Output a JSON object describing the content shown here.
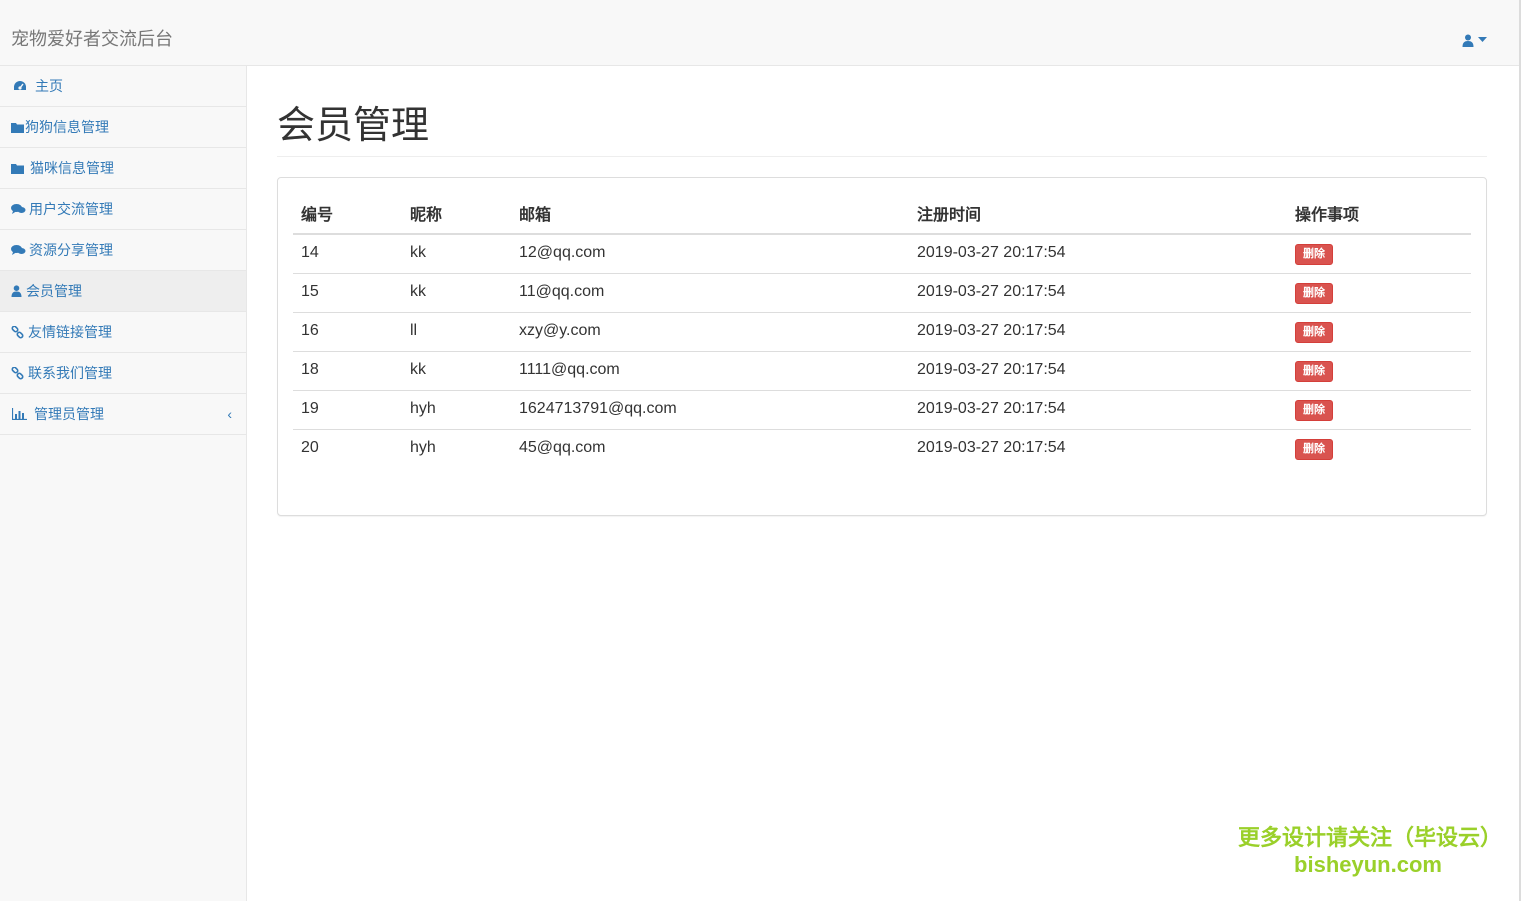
{
  "app": {
    "brand": "宠物爱好者交流后台"
  },
  "sidebar": {
    "items": [
      {
        "label": "主页",
        "icon": "dashboard-icon"
      },
      {
        "label": "狗狗信息管理",
        "icon": "folder-icon"
      },
      {
        "label": "猫咪信息管理",
        "icon": "folder-icon"
      },
      {
        "label": "用户交流管理",
        "icon": "comments-icon"
      },
      {
        "label": "资源分享管理",
        "icon": "comments-icon"
      },
      {
        "label": "会员管理",
        "icon": "user-icon",
        "active": true
      },
      {
        "label": "友情链接管理",
        "icon": "link-icon"
      },
      {
        "label": "联系我们管理",
        "icon": "link-icon"
      },
      {
        "label": "管理员管理",
        "icon": "bar-chart-icon",
        "arrow": "‹"
      }
    ]
  },
  "main": {
    "title": "会员管理",
    "table": {
      "headers": [
        "编号",
        "昵称",
        "邮箱",
        "注册时间",
        "操作事项"
      ],
      "rows": [
        {
          "id": "14",
          "nick": "kk",
          "email": "12@qq.com",
          "time": "2019-03-27 20:17:54",
          "action": "删除"
        },
        {
          "id": "15",
          "nick": "kk",
          "email": "11@qq.com",
          "time": "2019-03-27 20:17:54",
          "action": "删除"
        },
        {
          "id": "16",
          "nick": "ll",
          "email": "xzy@y.com",
          "time": "2019-03-27 20:17:54",
          "action": "删除"
        },
        {
          "id": "18",
          "nick": "kk",
          "email": "1111@qq.com",
          "time": "2019-03-27 20:17:54",
          "action": "删除"
        },
        {
          "id": "19",
          "nick": "hyh",
          "email": "1624713791@qq.com",
          "time": "2019-03-27 20:17:54",
          "action": "删除"
        },
        {
          "id": "20",
          "nick": "hyh",
          "email": "45@qq.com",
          "time": "2019-03-27 20:17:54",
          "action": "删除"
        }
      ]
    }
  },
  "watermark": {
    "line1": "更多设计请关注（毕设云）",
    "line2": "bisheyun.com"
  },
  "colors": {
    "link": "#337ab7",
    "danger": "#d9534f",
    "watermark": "#9ad02a"
  }
}
